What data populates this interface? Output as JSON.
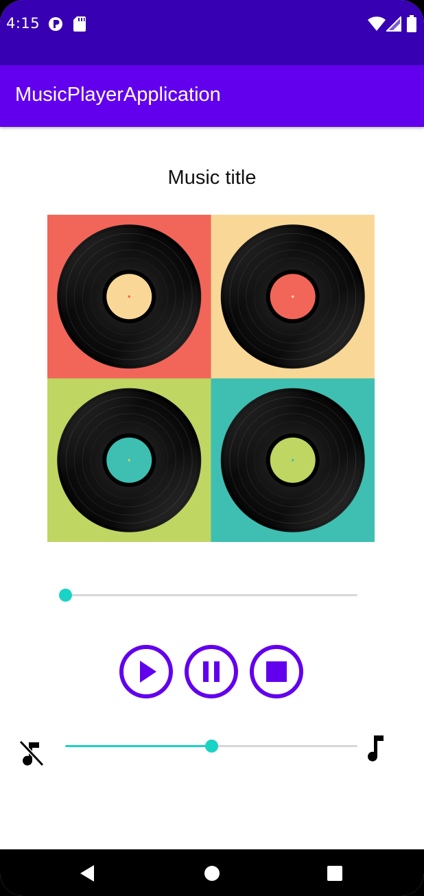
{
  "status_bar": {
    "time": "4:15",
    "icons": [
      "data-saver-icon",
      "sd-card-icon",
      "wifi-icon",
      "cell-signal-icon",
      "battery-icon"
    ],
    "background": "#3700b3"
  },
  "app_bar": {
    "title": "MusicPlayerApplication",
    "background": "#6200ee"
  },
  "player": {
    "music_title": "Music title",
    "album_art": {
      "icon": "vinyl-records-icon",
      "tiles": [
        {
          "background": "#f26659",
          "label_color": "#f9d897"
        },
        {
          "background": "#f9d897",
          "label_color": "#f26659"
        },
        {
          "background": "#bfd662",
          "label_color": "#3ebfb1"
        },
        {
          "background": "#3ebfb1",
          "label_color": "#bfd662"
        }
      ]
    },
    "seek_progress": 0.0,
    "buttons": [
      {
        "name": "play",
        "icon": "play-icon"
      },
      {
        "name": "pause",
        "icon": "pause-icon"
      },
      {
        "name": "stop",
        "icon": "stop-icon"
      }
    ],
    "volume_level": 0.5,
    "volume_min_icon": "music-off-icon",
    "volume_max_icon": "music-note-icon"
  },
  "colors": {
    "accent": "#19d3c5",
    "primary": "#6200ee",
    "track": "#d7d7d7"
  },
  "nav_bar": {
    "buttons": [
      "back-icon",
      "home-icon",
      "recents-icon"
    ]
  }
}
